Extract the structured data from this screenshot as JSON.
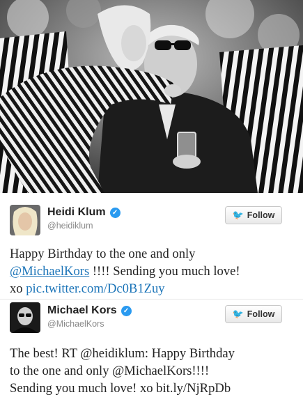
{
  "tweets": [
    {
      "name": "Heidi Klum",
      "handle": "@heidiklum",
      "follow_label": "Follow",
      "text_line1": "Happy Birthday to the one and only",
      "mention": "@MichaelKors",
      "text_line2_rest": " !!!! Sending you much love!",
      "text_line3_prefix": "xo ",
      "link": "pic.twitter.com/Dc0B1Zuy"
    },
    {
      "name": "Michael Kors",
      "handle": "@MichaelKors",
      "follow_label": "Follow",
      "text_line1": "The best! RT @heidiklum: Happy Birthday",
      "text_line2": "to the one and only @MichaelKors!!!!",
      "text_line3": "Sending you much love! xo bit.ly/NjRpDb"
    }
  ],
  "icons": {
    "verified": "verified-badge-icon",
    "bird": "twitter-bird-icon"
  },
  "colors": {
    "link": "#1b74b8",
    "verified": "#2a9af0"
  }
}
